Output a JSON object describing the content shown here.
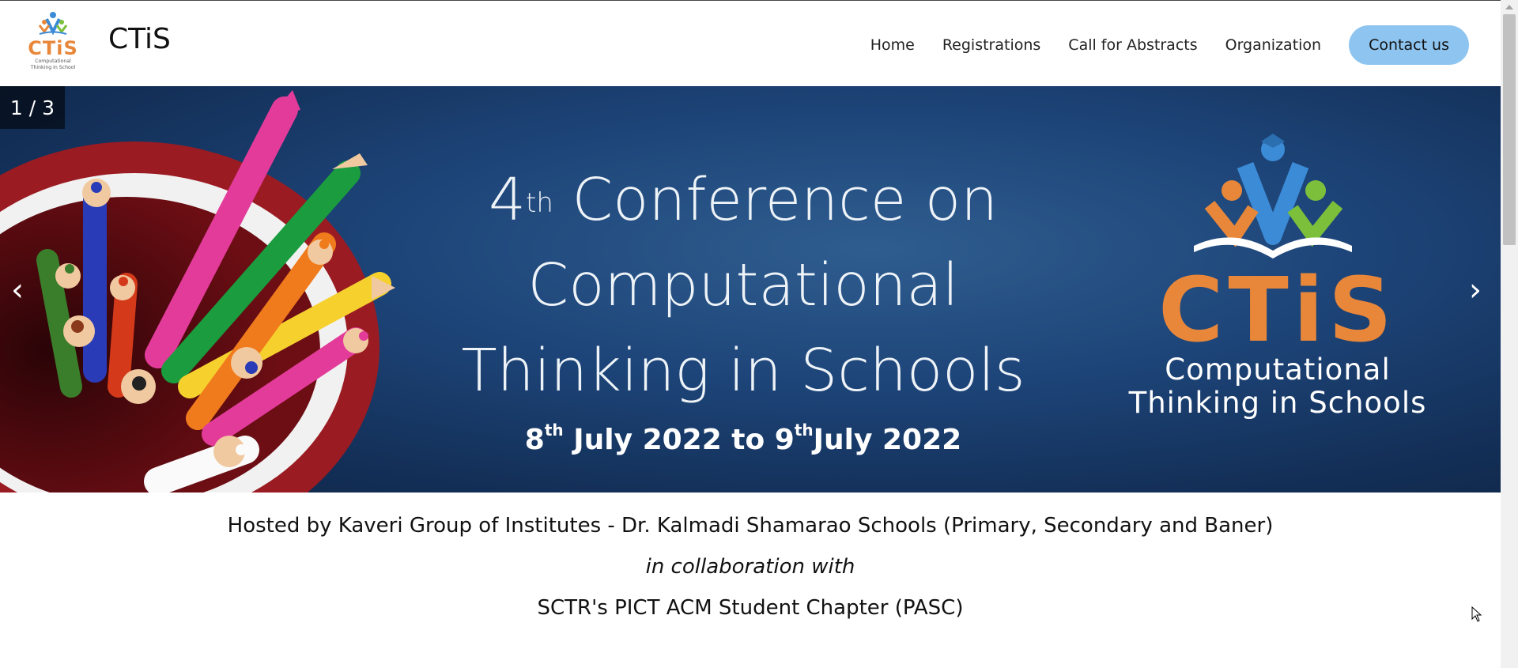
{
  "header": {
    "logo": {
      "icon": "ctis-logo-icon",
      "text": "CTiS",
      "caption": "Computational Thinking in School"
    },
    "brand": "CTiS",
    "nav": [
      {
        "label": "Home"
      },
      {
        "label": "Registrations"
      },
      {
        "label": "Call for Abstracts"
      },
      {
        "label": "Organization"
      }
    ],
    "contact_label": "Contact us"
  },
  "hero": {
    "counter": "1 / 3",
    "ordinal": "4",
    "ordinal_suffix": "th",
    "line1": "Conference on",
    "line2": "Computational",
    "line3": "Thinking in Schools",
    "date_start_day": "8",
    "date_start_suffix": "th",
    "date_mid": "July 2022 to 9",
    "date_end_suffix": "th",
    "date_end": "July 2022",
    "logo_text": "CTiS",
    "logo_sub1": "Computational",
    "logo_sub2": "Thinking in Schools",
    "prev_arrow": "‹",
    "next_arrow": "›"
  },
  "info": {
    "host": "Hosted by Kaveri Group of Institutes - Dr. Kalmadi Shamarao Schools (Primary, Secondary and Baner)",
    "collab": "in collaboration with",
    "chapter": "SCTR's PICT ACM Student Chapter (PASC)"
  },
  "colors": {
    "accent_orange": "#e8873a",
    "contact_button": "#8ec5f0",
    "hero_blue": "#1d4478"
  }
}
